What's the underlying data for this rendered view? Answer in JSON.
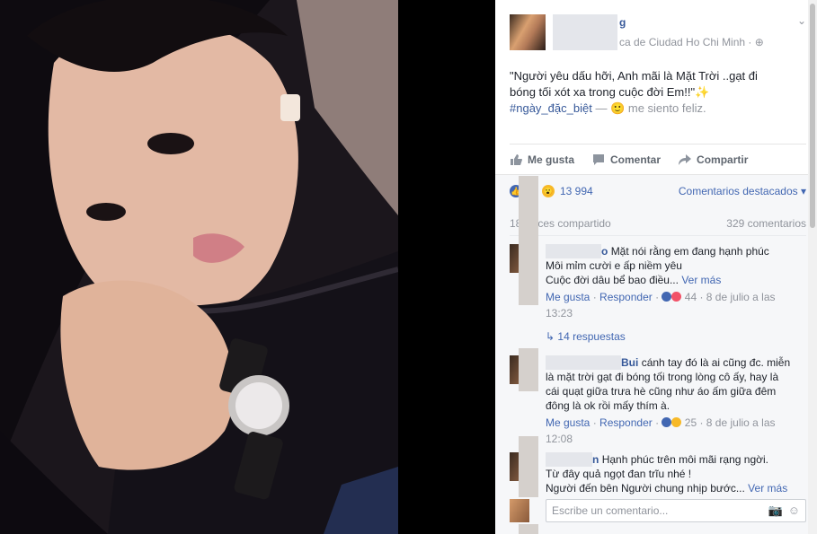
{
  "post": {
    "location": "ca de Ciudad Ho Chi Minh",
    "name_tail": "g",
    "text_line1": "\"Người yêu dấu hỡi, Anh mãi là Mặt Trời ..gạt đi",
    "text_line2": "bóng tối xót xa trong cuộc đời Em!!\"",
    "hashtag": "#ngày_đặc_biệt",
    "dash": "—",
    "feeling": "me siento feliz."
  },
  "actions": {
    "like": "Me gusta",
    "comment": "Comentar",
    "share": "Compartir"
  },
  "reactions": {
    "count": "13 994",
    "sort_label": "Comentarios destacados"
  },
  "stats": {
    "shares": "18",
    "shares_suffix": "ces compartido",
    "comments": "329 comentarios"
  },
  "comments": [
    {
      "name_tail": "o",
      "line1": "Mặt nói rằng em đang hạnh phúc",
      "line2": "Môi mỉm cười e ấp niềm yêu",
      "line3": "Cuộc đời dâu bể bao điều...",
      "more": "Ver más",
      "like": "Me gusta",
      "reply": "Responder",
      "react_count": "44",
      "date": "8 de julio a las",
      "time": "13:23"
    },
    {
      "name_tail": "Bui",
      "line1": "cánh tay đó là ai cũng đc. miễn",
      "line2": "là mặt trời gạt đi bóng tối trong lòng cô ấy, hay là",
      "line3": "cái quạt giữa trưa hè cũng như áo ấm giữa đêm",
      "line4": "đông là ok rồi mấy thím à.",
      "like": "Me gusta",
      "reply": "Responder",
      "react_count": "25",
      "date": "8 de julio a las",
      "time": "12:08"
    },
    {
      "name_tail": "n",
      "line1": "Hạnh phúc trên môi mãi rạng ngời.",
      "line2": "Từ đây quả ngọt đan trĩu nhé !",
      "line3": "Người đến bên Người chung nhịp bước...",
      "more": "Ver más"
    }
  ],
  "replies": "14 respuestas",
  "compose": {
    "placeholder": "Escribe un comentario..."
  }
}
